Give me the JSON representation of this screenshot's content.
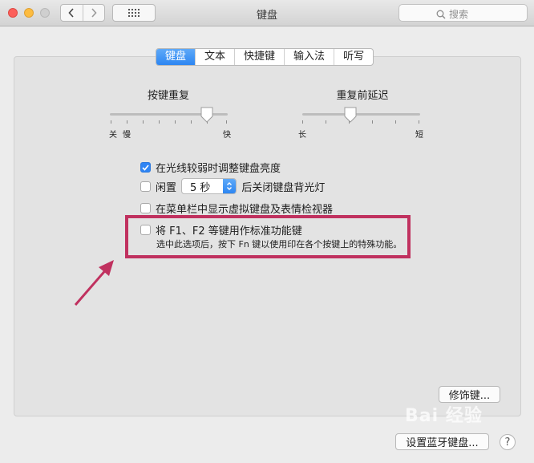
{
  "window": {
    "title": "键盘"
  },
  "search": {
    "placeholder": "搜索"
  },
  "tabs": [
    {
      "label": "键盘",
      "active": true
    },
    {
      "label": "文本"
    },
    {
      "label": "快捷键"
    },
    {
      "label": "输入法"
    },
    {
      "label": "听写"
    }
  ],
  "key_repeat": {
    "label": "按键重复",
    "left": "关",
    "left2": "慢",
    "right": "快",
    "level": 0.86
  },
  "delay_until_repeat": {
    "label": "重复前延迟",
    "left": "长",
    "right": "短",
    "level": 0.41
  },
  "options": {
    "adjust_brightness": {
      "label": "在光线较弱时调整键盘亮度",
      "checked": true
    },
    "backlight_off": {
      "prefix": "闲置",
      "value": "5 秒",
      "suffix": "后关闭键盘背光灯",
      "checked": false
    },
    "show_viewer": {
      "label": "在菜单栏中显示虚拟键盘及表情检视器",
      "checked": false
    },
    "fn_keys": {
      "label": "将 F1、F2 等键用作标准功能键",
      "note": "选中此选项后，按下 Fn 键以使用印在各个按键上的特殊功能。",
      "checked": false
    }
  },
  "buttons": {
    "modifier_keys": "修饰键...",
    "bluetooth_keyboard": "设置蓝牙键盘...",
    "help": "?"
  },
  "watermark": "Bai 经验",
  "colors": {
    "accent": "#2f84f4",
    "highlight": "#c0315f"
  }
}
